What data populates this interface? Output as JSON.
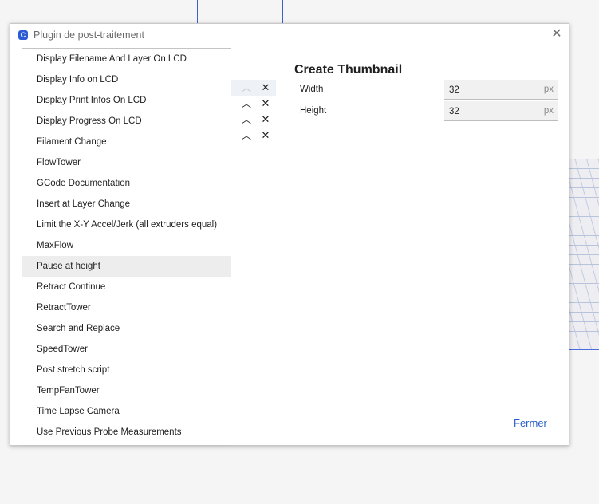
{
  "dialog": {
    "title": "Plugin de post-traitement",
    "app_icon_glyph": "C",
    "close_glyph": "✕",
    "close_button_label": "Fermer"
  },
  "scripts": [
    {
      "label": "Display Filename And Layer On LCD"
    },
    {
      "label": "Display Info on LCD"
    },
    {
      "label": "Display Print Infos On LCD"
    },
    {
      "label": "Display Progress On LCD"
    },
    {
      "label": "Filament Change"
    },
    {
      "label": "FlowTower"
    },
    {
      "label": "GCode Documentation"
    },
    {
      "label": "Insert at Layer Change"
    },
    {
      "label": "Limit the X-Y Accel/Jerk (all extruders equal)"
    },
    {
      "label": "MaxFlow"
    },
    {
      "label": "Pause at height",
      "selected": true
    },
    {
      "label": "Retract Continue"
    },
    {
      "label": "RetractTower"
    },
    {
      "label": "Search and Replace"
    },
    {
      "label": "SpeedTower"
    },
    {
      "label": "Post stretch script"
    },
    {
      "label": "TempFanTower"
    },
    {
      "label": "Time Lapse Camera"
    },
    {
      "label": "Use Previous Probe Measurements"
    }
  ],
  "active_scripts_controls": [
    {
      "up_disabled": true,
      "highlight": true
    },
    {
      "up_disabled": false
    },
    {
      "up_disabled": false
    },
    {
      "up_disabled": false
    }
  ],
  "icons": {
    "up": "chevron-up-icon",
    "delete": "close-icon",
    "up_glyph": "︿",
    "delete_glyph": "✕"
  },
  "settings": {
    "title": "Create Thumbnail",
    "fields": [
      {
        "label": "Width",
        "value": "32",
        "unit": "px"
      },
      {
        "label": "Height",
        "value": "32",
        "unit": "px"
      }
    ]
  },
  "colors": {
    "accent": "#2a5fc9",
    "selected_row": "#ededed"
  }
}
